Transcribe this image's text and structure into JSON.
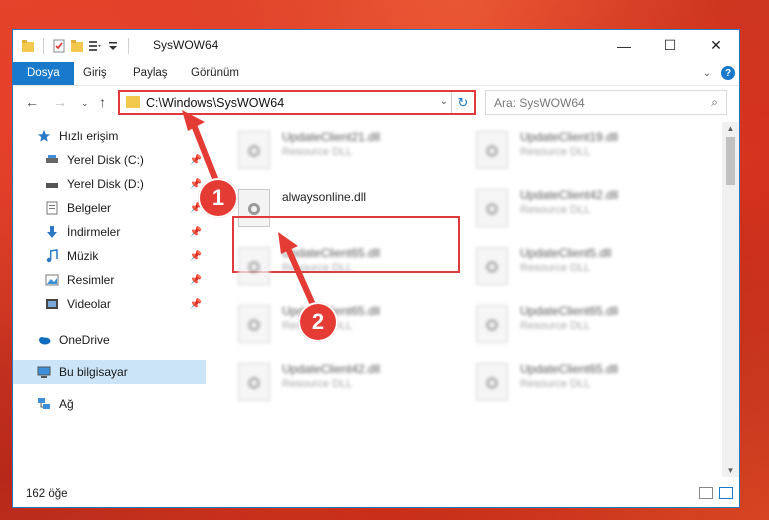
{
  "window": {
    "title": "SysWOW64",
    "controls": {
      "minimize": "—",
      "maximize": "☐",
      "close": "✕"
    }
  },
  "ribbon": {
    "tabs": [
      "Dosya",
      "Giriş",
      "Paylaş",
      "Görünüm"
    ]
  },
  "nav": {
    "address": "C:\\Windows\\SysWOW64",
    "search_placeholder": "Ara: SysWOW64"
  },
  "sidebar": {
    "items": [
      {
        "label": "Hızlı erişim",
        "icon": "star-icon"
      },
      {
        "label": "Yerel Disk (C:)",
        "icon": "drive-icon",
        "pinned": true
      },
      {
        "label": "Yerel Disk (D:)",
        "icon": "drive-icon",
        "pinned": true
      },
      {
        "label": "Belgeler",
        "icon": "documents-icon",
        "pinned": true
      },
      {
        "label": "İndirmeler",
        "icon": "download-icon",
        "pinned": true
      },
      {
        "label": "Müzik",
        "icon": "music-icon",
        "pinned": true
      },
      {
        "label": "Resimler",
        "icon": "pictures-icon",
        "pinned": true
      },
      {
        "label": "Videolar",
        "icon": "videos-icon",
        "pinned": true
      },
      {
        "label": "OneDrive",
        "icon": "cloud-icon"
      },
      {
        "label": "Bu bilgisayar",
        "icon": "computer-icon",
        "selected": true
      },
      {
        "label": "Ağ",
        "icon": "network-icon"
      }
    ]
  },
  "files": [
    {
      "name": "UpdateClient21.dll",
      "desc": "Resource DLL"
    },
    {
      "name": "UpdateClient19.dll",
      "desc": "Resource DLL"
    },
    {
      "name": "alwaysonline.dll",
      "desc": ""
    },
    {
      "name": "UpdateClient42.dll",
      "desc": "Resource DLL"
    },
    {
      "name": "UpdateClient65.dll",
      "desc": "Resource DLL"
    },
    {
      "name": "UpdateClient5.dll",
      "desc": "Resource DLL"
    },
    {
      "name": "UpdateClient65.dll",
      "desc": "Resource DLL"
    },
    {
      "name": "UpdateClient65.dll",
      "desc": "Resource DLL"
    },
    {
      "name": "UpdateClient42.dll",
      "desc": "Resource DLL"
    },
    {
      "name": "UpdateClient65.dll",
      "desc": "Resource DLL"
    }
  ],
  "status": {
    "count": "162 öğe"
  },
  "annotations": {
    "step1": "1",
    "step2": "2"
  },
  "colors": {
    "accent": "#1979ca",
    "highlight": "#e03a3a"
  }
}
